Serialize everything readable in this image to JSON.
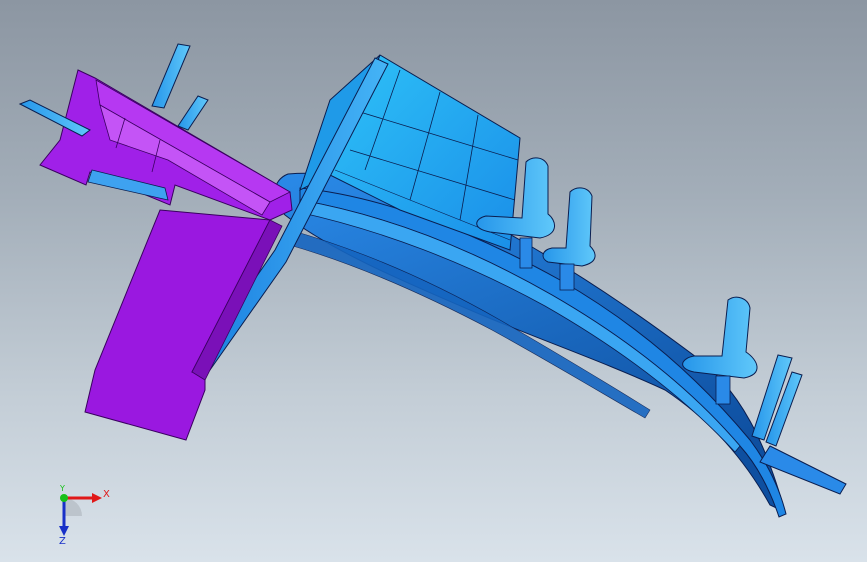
{
  "viewport": {
    "background_top": "#8c96a2",
    "background_bottom": "#d9e2ea"
  },
  "model": {
    "selected_part_color": "#a21ee6",
    "part_color": "#1e96f0",
    "part_dark_color": "#0a50a0",
    "edge_color": "#0a1e50"
  },
  "triad": {
    "x_label": "X",
    "y_label": "Y",
    "z_label": "Z",
    "x_color": "#e01818",
    "y_color": "#18c018",
    "z_color": "#1830c8"
  }
}
